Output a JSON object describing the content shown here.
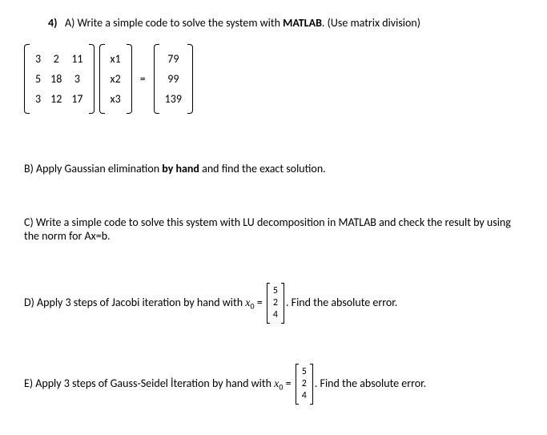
{
  "q_number": "4)",
  "partA_label": "A) Write a simple code to solve the system with ",
  "partA_bold": "MATLAB",
  "partA_tail": ". (Use matrix division)",
  "matrixA": [
    [
      "3",
      "2",
      "11"
    ],
    [
      "5",
      "18",
      "3"
    ],
    [
      "3",
      "12",
      "17"
    ]
  ],
  "vecX": [
    [
      "x1"
    ],
    [
      "x2"
    ],
    [
      "x3"
    ]
  ],
  "vecB": [
    [
      "79"
    ],
    [
      "99"
    ],
    [
      "139"
    ]
  ],
  "eq": "=",
  "partB_pre": "B) Apply Gaussian elimination ",
  "partB_bold": "by hand",
  "partB_tail": " and find the exact solution.",
  "partC": "C) Write a simple code to solve this system with LU decomposition in MATLAB and check the result by using the norm for Ax=b.",
  "partD_pre": "D) Apply 3 steps of Jacobi iteration by hand with ",
  "x0_var": "x",
  "x0_sub": "0",
  "partD_eq": " = ",
  "vecX0": [
    [
      "5"
    ],
    [
      "2"
    ],
    [
      "4"
    ]
  ],
  "partD_tail": ". Find the absolute error.",
  "partE_pre": "E) Apply 3 steps of Gauss-Seidel İteration by hand with ",
  "partE_tail": ". Find the absolute error."
}
